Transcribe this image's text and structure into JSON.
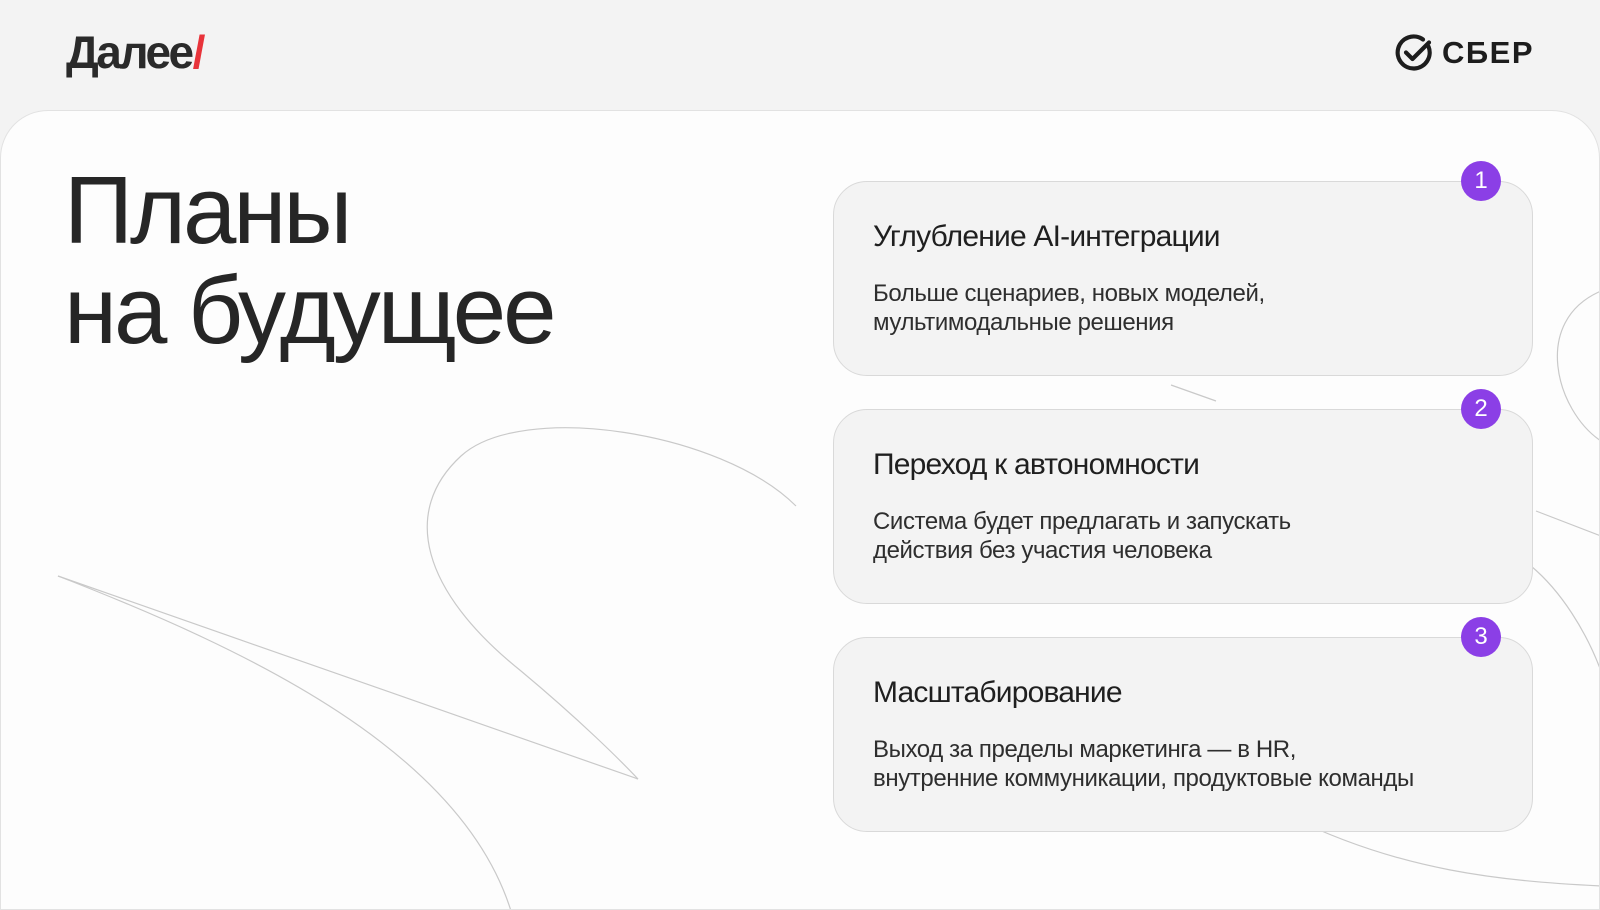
{
  "header": {
    "brand_left": "Далее",
    "brand_left_slash": "/",
    "brand_right": "СБЕР"
  },
  "main": {
    "title_lines": [
      "Планы",
      "на будущее"
    ]
  },
  "cards": [
    {
      "number": "1",
      "title": "Углубление AI-интеграции",
      "desc_lines": [
        "Больше сценариев, новых моделей,",
        "мультимодальные решения"
      ]
    },
    {
      "number": "2",
      "title": "Переход к автономности",
      "desc_lines": [
        "Система будет предлагать и запускать",
        "действия без участия человека"
      ]
    },
    {
      "number": "3",
      "title": "Масштабирование",
      "desc_lines": [
        "Выход за пределы маркетинга — в HR,",
        "внутренние коммуникации, продуктовые команды"
      ]
    }
  ],
  "colors": {
    "accent_slash": "#e8333a",
    "badge": "#8b3fe6",
    "card_bg": "#f3f3f3",
    "page_bg": "#f3f3f3",
    "panel_bg": "#fdfdfd"
  },
  "icons": {
    "brand_right": "sber-check-icon"
  }
}
